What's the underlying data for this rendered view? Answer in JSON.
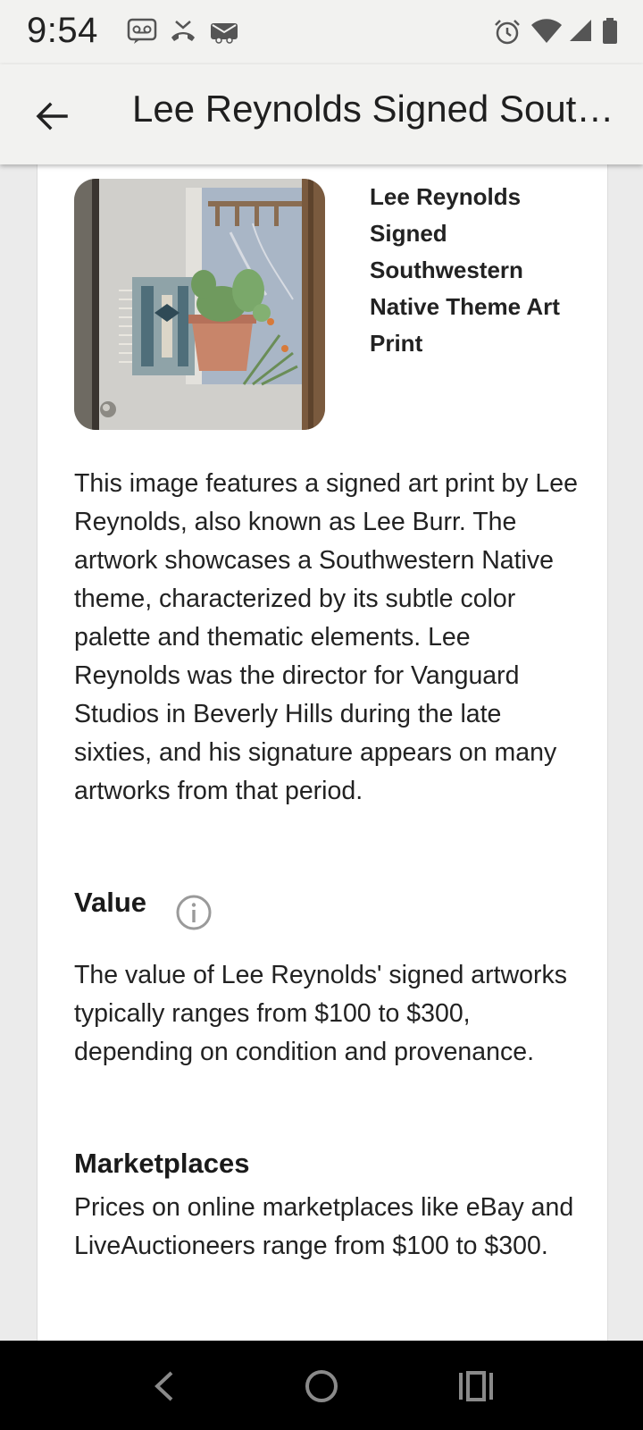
{
  "status_bar": {
    "time": "9:54",
    "notification_icons": [
      "voicemail-icon",
      "missed-call-icon",
      "game-controller-icon"
    ],
    "system_icons": [
      "alarm-icon",
      "wifi-icon",
      "cell-signal-icon",
      "battery-icon"
    ]
  },
  "app_bar": {
    "back_icon": "arrow-back-icon",
    "title": "Lee Reynolds Signed Southwestern Native Theme Art Print"
  },
  "item": {
    "image_alt": "art-print-thumbnail",
    "title": "Lee Reynolds Signed Southwestern Native Theme Art Print",
    "description": "This image features a signed art print by Lee Reynolds, also known as Lee Burr. The artwork showcases a Southwestern Native theme, characterized by its subtle color palette and thematic elements. Lee Reynolds was the director for Vanguard Studios in Beverly Hills during the late sixties, and his signature appears on many artworks from that period."
  },
  "value_section": {
    "heading": "Value",
    "info_icon": "info-icon",
    "text": "The value of Lee Reynolds' signed artworks typically ranges from $100 to $300, depending on condition and provenance."
  },
  "marketplaces_section": {
    "heading": "Marketplaces",
    "text": "Prices on online marketplaces like eBay and LiveAuctioneers range from $100 to $300."
  },
  "nav_bar": {
    "buttons": [
      "nav-back-icon",
      "nav-home-icon",
      "nav-recents-icon"
    ]
  },
  "colors": {
    "app_bar_bg": "#f2f2f0",
    "page_bg": "#ebebeb",
    "card_bg": "#ffffff",
    "text": "#1f1f1f",
    "nav_bar_bg": "#000000"
  }
}
